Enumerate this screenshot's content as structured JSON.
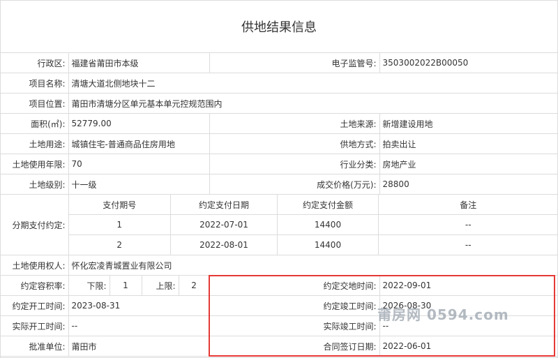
{
  "title": "供地结果信息",
  "region": {
    "label": "行政区:",
    "value": "福建省莆田市本级"
  },
  "supervision_no": {
    "label": "电子监管号:",
    "value": "3503002022B00050"
  },
  "project_name": {
    "label": "项目名称:",
    "value": "清塘大道北侧地块十二"
  },
  "project_location": {
    "label": "项目位置:",
    "value": "莆田市清塘分区单元基本单元控规范围内"
  },
  "area": {
    "label": "面积(㎡):",
    "value": "52779.00"
  },
  "land_source": {
    "label": "土地来源:",
    "value": "新增建设用地"
  },
  "land_use": {
    "label": "土地用途:",
    "value": "城镇住宅-普通商品住房用地"
  },
  "supply_method": {
    "label": "供地方式:",
    "value": "拍卖出让"
  },
  "use_term": {
    "label": "土地使用年限:",
    "value": "70"
  },
  "industry": {
    "label": "行业分类:",
    "value": "房地产业"
  },
  "land_grade": {
    "label": "土地级别:",
    "value": "十一级"
  },
  "price": {
    "label": "成交价格(万元):",
    "value": "28800"
  },
  "installments": {
    "label": "分期支付约定:",
    "headers": [
      "支付期号",
      "约定支付日期",
      "约定支付金额",
      "备注"
    ],
    "rows": [
      [
        "1",
        "2022-07-01",
        "14400",
        "--"
      ],
      [
        "2",
        "2022-08-01",
        "14400",
        "--"
      ]
    ]
  },
  "land_user": {
    "label": "土地使用权人:",
    "value": "怀化宏凌青城置业有限公司"
  },
  "plot_ratio": {
    "label": "约定容积率:",
    "lower_label": "下限:",
    "lower": "1",
    "upper_label": "上限:",
    "upper": "2"
  },
  "delivery_time": {
    "label": "约定交地时间:",
    "value": "2022-09-01"
  },
  "start_time": {
    "label": "约定开工时间:",
    "value": "2023-08-31"
  },
  "finish_time": {
    "label": "约定竣工时间:",
    "value": "2026-08-30"
  },
  "actual_start": {
    "label": "实际开工时间:",
    "value": "--"
  },
  "actual_finish": {
    "label": "实际竣工时间:",
    "value": "--"
  },
  "approval_unit": {
    "label": "批准单位:",
    "value": "莆田市"
  },
  "contract_date": {
    "label": "合同签订日期:",
    "value": "2022-06-01"
  },
  "watermark": "莆房网 0594.com",
  "colors": {
    "highlight_border": "#e53935",
    "grid_line": "#dcdcdc",
    "text": "#333333"
  }
}
